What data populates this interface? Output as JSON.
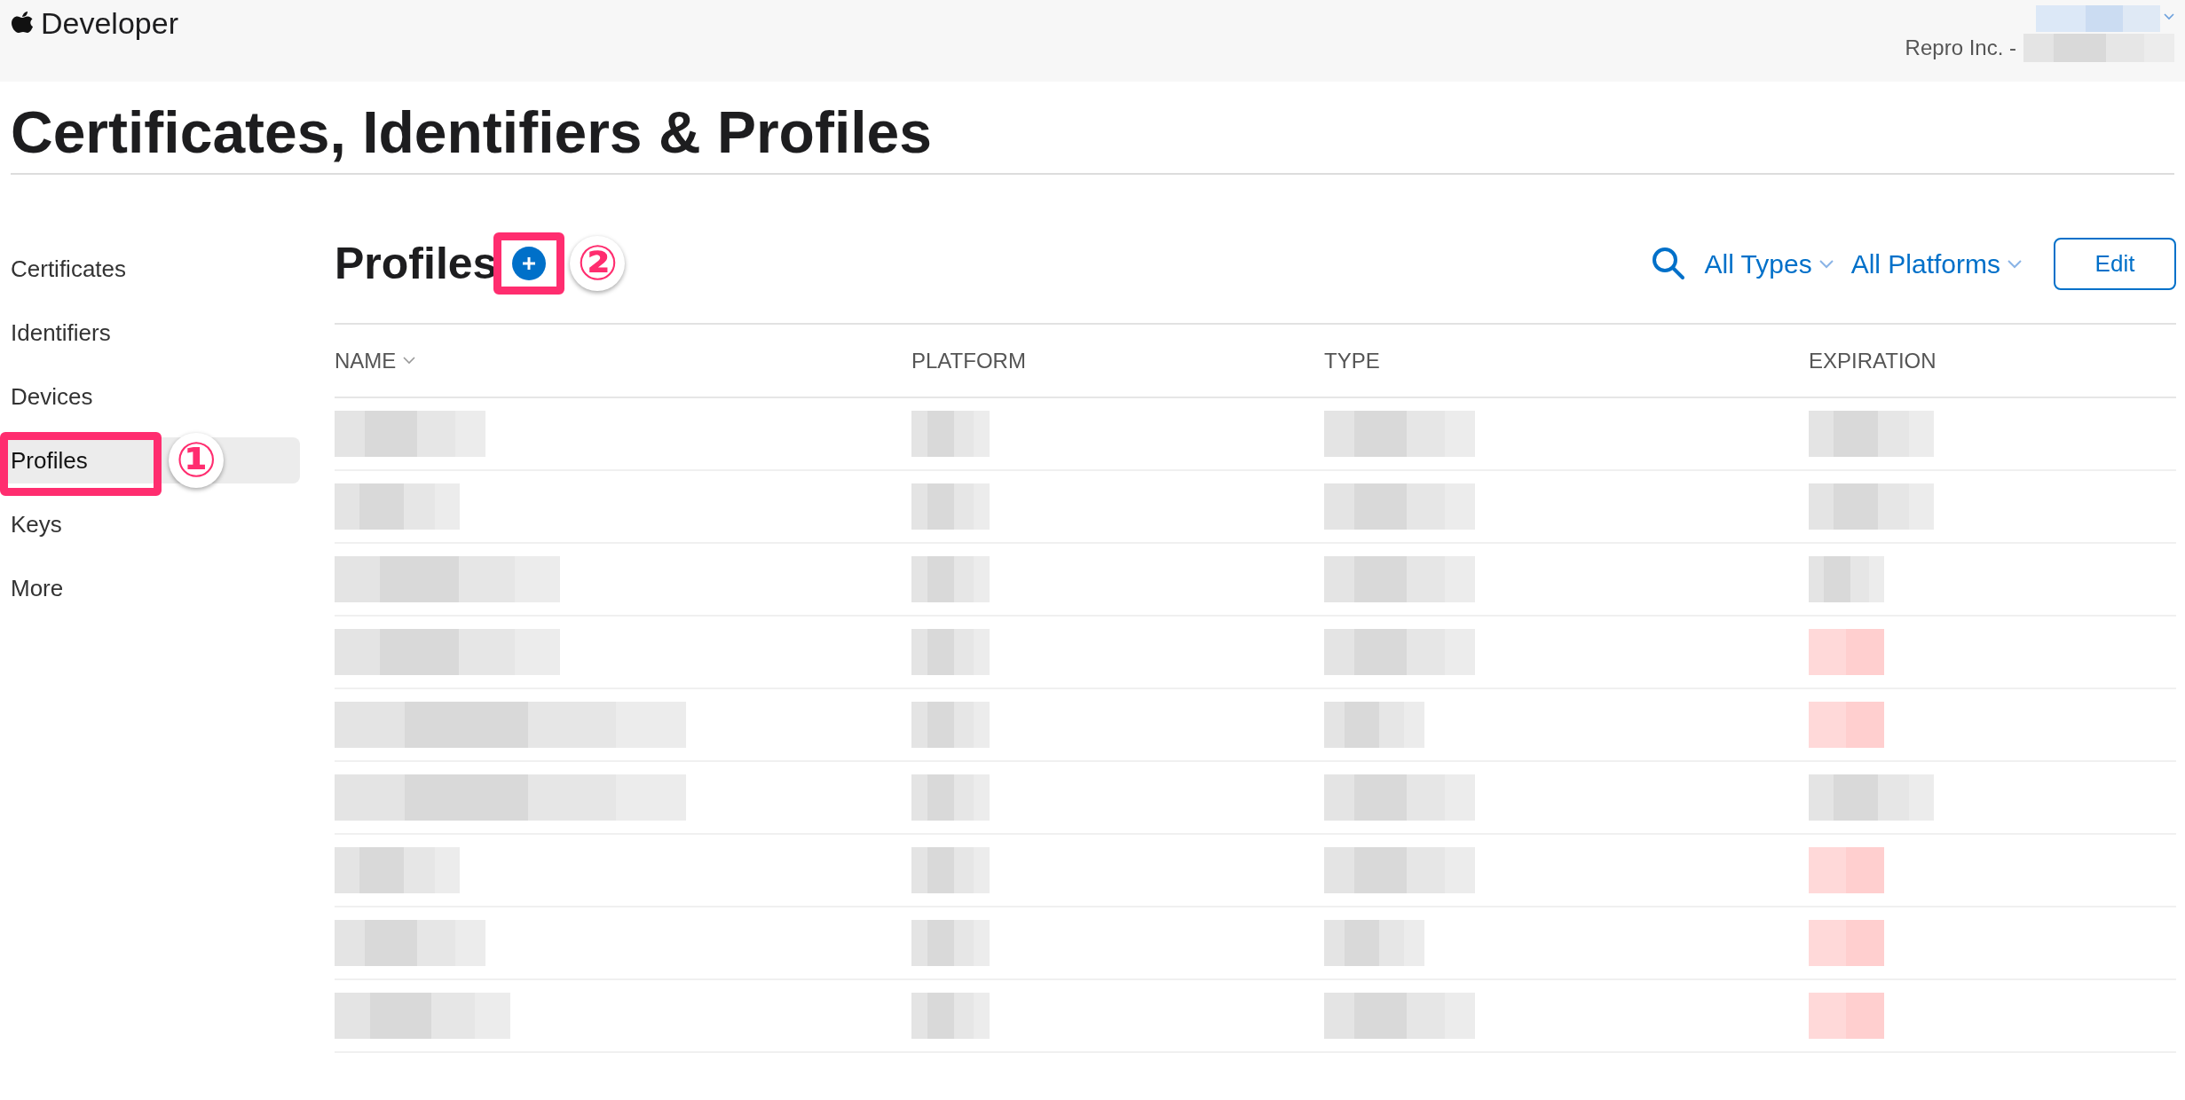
{
  "header": {
    "brand": "Developer",
    "account": "Repro Inc. -"
  },
  "page_title": "Certificates, Identifiers & Profiles",
  "sidebar": {
    "items": [
      {
        "label": "Certificates",
        "selected": false
      },
      {
        "label": "Identifiers",
        "selected": false
      },
      {
        "label": "Devices",
        "selected": false
      },
      {
        "label": "Profiles",
        "selected": true,
        "annotation": "①"
      },
      {
        "label": "Keys",
        "selected": false
      },
      {
        "label": "More",
        "selected": false
      }
    ]
  },
  "section": {
    "title": "Profiles",
    "add_annotation": "②",
    "filters": [
      {
        "label": "All Types"
      },
      {
        "label": "All Platforms"
      }
    ],
    "edit_button": "Edit"
  },
  "table": {
    "columns": [
      {
        "label": "NAME",
        "sortable": true
      },
      {
        "label": "PLATFORM",
        "sortable": false
      },
      {
        "label": "TYPE",
        "sortable": false
      },
      {
        "label": "EXPIRATION",
        "sortable": false
      }
    ],
    "rows": [
      {
        "expired": false
      },
      {
        "expired": false
      },
      {
        "expired": false
      },
      {
        "expired": true
      },
      {
        "expired": true
      },
      {
        "expired": false
      },
      {
        "expired": true
      },
      {
        "expired": true
      },
      {
        "expired": true
      }
    ]
  }
}
